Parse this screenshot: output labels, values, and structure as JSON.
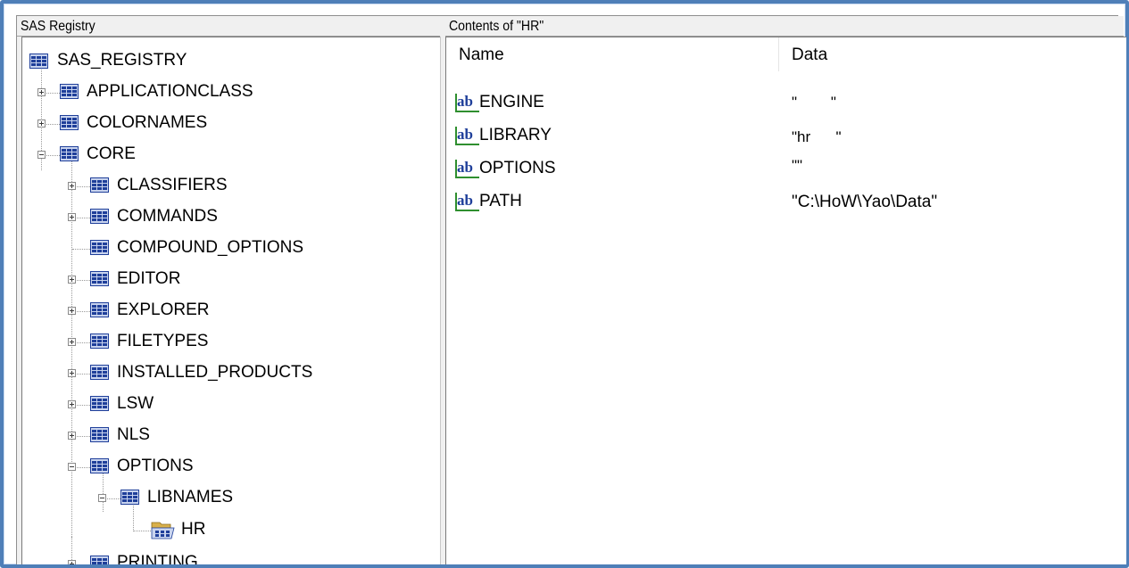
{
  "left_title": "SAS Registry",
  "right_title": "Contents of \"HR\"",
  "tree": {
    "root": "SAS_REGISTRY",
    "applicationclass": "APPLICATIONCLASS",
    "colornames": "COLORNAMES",
    "core": "CORE",
    "classifiers": "CLASSIFIERS",
    "commands": "COMMANDS",
    "compound_options": "COMPOUND_OPTIONS",
    "editor": "EDITOR",
    "explorer": "EXPLORER",
    "filetypes": "FILETYPES",
    "installed_products": "INSTALLED_PRODUCTS",
    "lsw": "LSW",
    "nls": "NLS",
    "options": "OPTIONS",
    "libnames": "LIBNAMES",
    "hr": "HR",
    "printing": "PRINTING"
  },
  "columns": {
    "name": "Name",
    "data": "Data"
  },
  "rows": [
    {
      "name": "ENGINE",
      "data": "\"        \""
    },
    {
      "name": "LIBRARY",
      "data": "\"hr      \""
    },
    {
      "name": "OPTIONS",
      "data": "\"\""
    },
    {
      "name": "PATH",
      "data": "\"C:\\HoW\\Yao\\Data\""
    }
  ],
  "icons": {
    "folder": "registry-key-icon",
    "open_folder": "open-registry-key-icon",
    "value": "string-value-icon"
  },
  "colors": {
    "frame": "#4f7fb8",
    "icon_blue": "#1f3f9a",
    "icon_green": "#2f8f2f"
  }
}
